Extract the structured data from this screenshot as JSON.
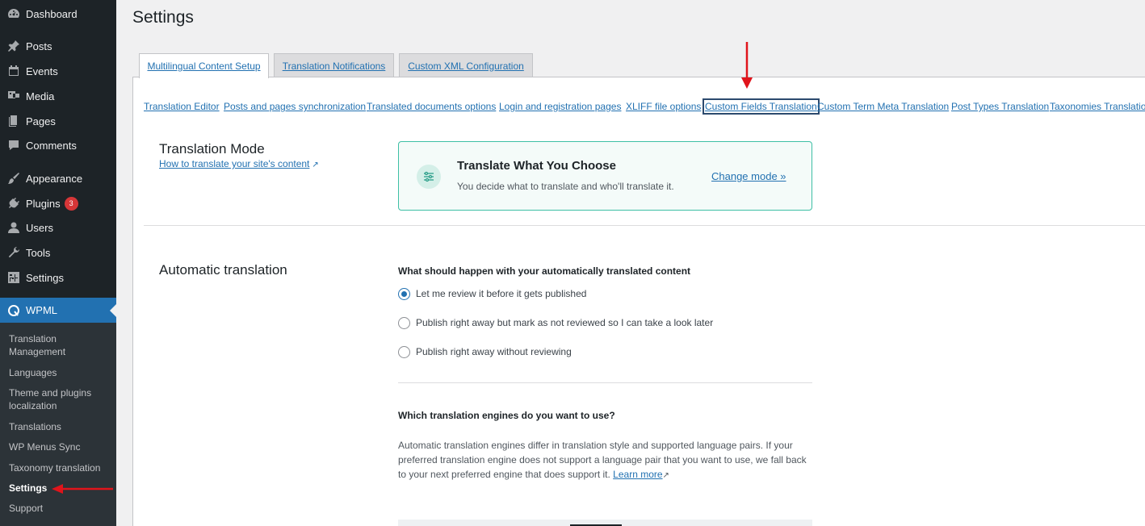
{
  "sidebar": {
    "items": [
      {
        "label": "Dashboard",
        "icon": "dashboard-icon"
      },
      {
        "label": "Posts",
        "icon": "pin-icon"
      },
      {
        "label": "Events",
        "icon": "calendar-icon"
      },
      {
        "label": "Media",
        "icon": "media-icon"
      },
      {
        "label": "Pages",
        "icon": "pages-icon"
      },
      {
        "label": "Comments",
        "icon": "comment-icon"
      },
      {
        "label": "Appearance",
        "icon": "brush-icon"
      },
      {
        "label": "Plugins",
        "icon": "plugin-icon",
        "badge": "3"
      },
      {
        "label": "Users",
        "icon": "user-icon"
      },
      {
        "label": "Tools",
        "icon": "wrench-icon"
      },
      {
        "label": "Settings",
        "icon": "settings-icon"
      }
    ],
    "wpml": {
      "label": "WPML",
      "icon": "wpml-icon"
    },
    "submenu": [
      "Translation Management",
      "Languages",
      "Theme and plugins localization",
      "Translations",
      "WP Menus Sync",
      "Taxonomy translation",
      "Settings",
      "Support"
    ]
  },
  "page": {
    "title": "Settings"
  },
  "tabs": [
    "Multilingual Content Setup",
    "Translation Notifications",
    "Custom XML Configuration"
  ],
  "subnav": [
    "Translation Editor",
    "Posts and pages synchronization",
    "Translated documents options",
    "Login and registration pages",
    "XLIFF file options",
    "Custom Fields Translation",
    "Custom Term Meta Translation",
    "Post Types Translation",
    "Taxonomies Translation"
  ],
  "translation_mode": {
    "heading": "Translation Mode",
    "help_link": "How to translate your site's content",
    "card_title": "Translate What You Choose",
    "card_desc": "You decide what to translate and who'll translate it.",
    "change_link": "Change mode »"
  },
  "automatic": {
    "heading": "Automatic translation",
    "question": "What should happen with your automatically translated content",
    "options": [
      {
        "label": "Let me review it before it gets published",
        "checked": true
      },
      {
        "label": "Publish right away but mark as not reviewed so I can take a look later",
        "checked": false
      },
      {
        "label": "Publish right away without reviewing",
        "checked": false
      }
    ],
    "engines_question": "Which translation engines do you want to use?",
    "engines_desc": "Automatic translation engines differ in translation style and supported language pairs. If your preferred translation engine does not support a language pair that you want to use, we fall back to your next preferred engine that does support it.",
    "learn_more": "Learn more"
  },
  "colors": {
    "accent": "#2271b1",
    "sidebar_bg": "#1d2327",
    "card_border": "#3ebfa5",
    "annotation": "#e0141b"
  }
}
